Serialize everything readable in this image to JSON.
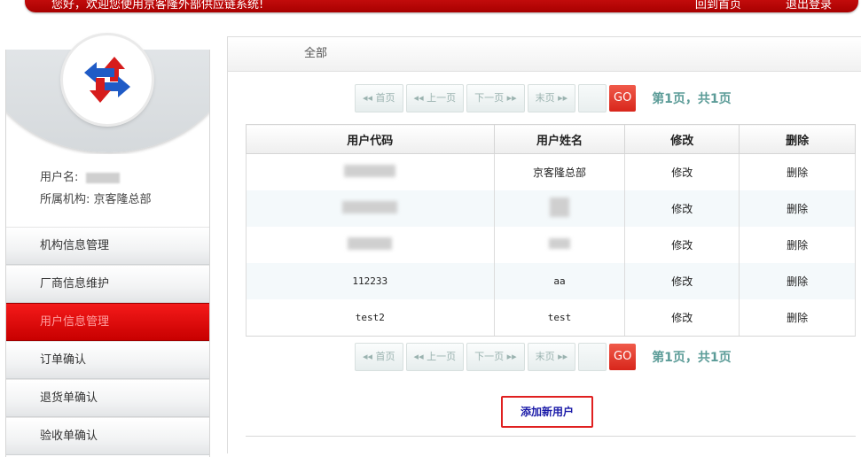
{
  "topbar": {
    "greeting": "您好，欢迎您使用京客隆外部供应链系统!",
    "home_link": "回到首页",
    "logout_link": "退出登录"
  },
  "sidebar": {
    "username_label": "用户名:",
    "org_label": "所属机构:",
    "org_value": "京客隆总部",
    "items": [
      {
        "label": "机构信息管理"
      },
      {
        "label": "厂商信息维护"
      },
      {
        "label": "用户信息管理"
      },
      {
        "label": "订单确认"
      },
      {
        "label": "退货单确认"
      },
      {
        "label": "验收单确认"
      }
    ]
  },
  "main": {
    "breadcrumb": "全部",
    "pager": {
      "first": "◂◂ 首页",
      "prev": "◂◂ 上一页",
      "next": "下一页 ▸▸",
      "last": "末页 ▸▸",
      "go": "GO",
      "info": "第1页，共1页"
    },
    "table": {
      "headers": [
        "用户代码",
        "用户姓名",
        "修改",
        "删除"
      ],
      "rows": [
        {
          "code": "",
          "name": "京客隆总部",
          "edit": "修改",
          "delete": "删除"
        },
        {
          "code": "",
          "name": "",
          "edit": "修改",
          "delete": "删除"
        },
        {
          "code": "",
          "name": "",
          "edit": "修改",
          "delete": "删除"
        },
        {
          "code": "112233",
          "name": "aa",
          "edit": "修改",
          "delete": "删除"
        },
        {
          "code": "test2",
          "name": "test",
          "edit": "修改",
          "delete": "删除"
        }
      ]
    },
    "add_user_button": "添加新用户"
  },
  "colors": {
    "brand_red": "#c80000",
    "pager_text": "#5c9c98",
    "add_button_text": "#1a1aa8"
  }
}
